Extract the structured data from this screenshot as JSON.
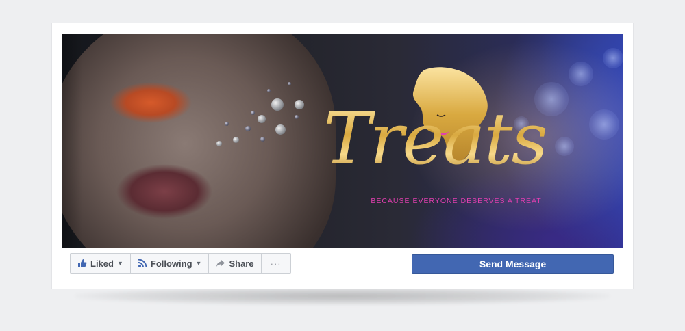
{
  "cover": {
    "brand_name": "Treats",
    "tagline": "BECAUSE EVERYONE DESERVES A TREAT"
  },
  "actions": {
    "liked": {
      "label": "Liked",
      "icon": "thumbs-up-icon"
    },
    "following": {
      "label": "Following",
      "icon": "rss-icon"
    },
    "share": {
      "label": "Share",
      "icon": "share-arrow-icon"
    },
    "more": {
      "label": "···",
      "icon": "more-dots-icon"
    },
    "send_message": {
      "label": "Send Message"
    }
  },
  "colors": {
    "brand_blue": "#4267b2",
    "gold": "#d9b45a",
    "tagline_pink": "#e23fb0"
  }
}
